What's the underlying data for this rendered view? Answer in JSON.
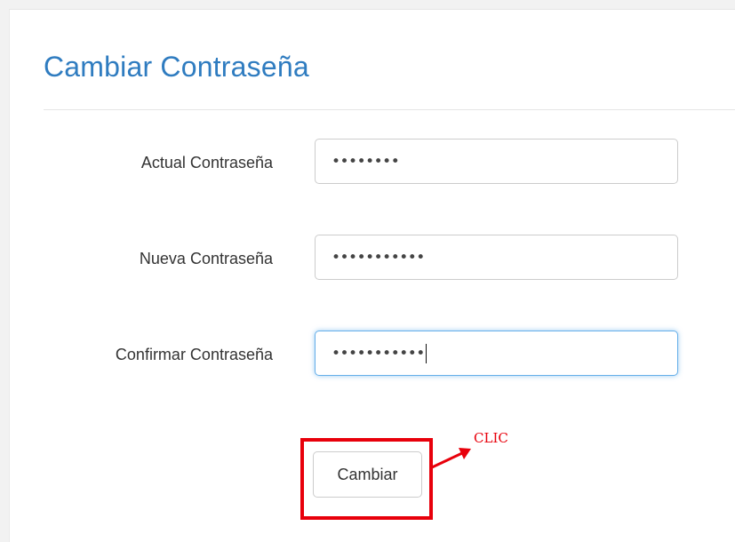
{
  "page": {
    "title": "Cambiar Contraseña"
  },
  "form": {
    "fields": [
      {
        "label": "Actual Contraseña",
        "masked_value": "••••••••",
        "length": 8
      },
      {
        "label": "Nueva Contraseña",
        "masked_value": "•••••••••••",
        "length": 11
      },
      {
        "label": "Confirmar Contraseña",
        "masked_value": "•••••••••••",
        "length": 11
      }
    ],
    "submit_label": "Cambiar"
  },
  "annotation": {
    "label": "CLIC",
    "color": "#e8000b"
  },
  "colors": {
    "title": "#2f7cc0",
    "focus_border": "#66afe9"
  }
}
